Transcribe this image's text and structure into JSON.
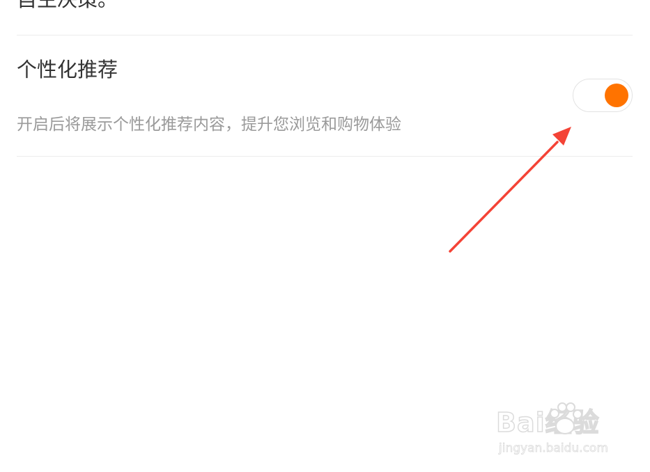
{
  "previous_section": {
    "text": "自主决策。"
  },
  "personalized_recommendation": {
    "title": "个性化推荐",
    "description": "开启后将展示个性化推荐内容，提升您浏览和购物体验",
    "toggle_on": true
  },
  "colors": {
    "accent": "#ff7300",
    "annotation_arrow": "#f44336",
    "title_text": "#333333",
    "description_text": "#9a9a9a",
    "divider": "#ececec"
  },
  "icons": {
    "toggle_knob": "toggle-knob-circle",
    "annotation": "red-arrow-icon",
    "watermark_paw": "paw-icon"
  },
  "watermark": {
    "logo_text": "Bai经验",
    "url": "jingyan.baidu.com"
  }
}
